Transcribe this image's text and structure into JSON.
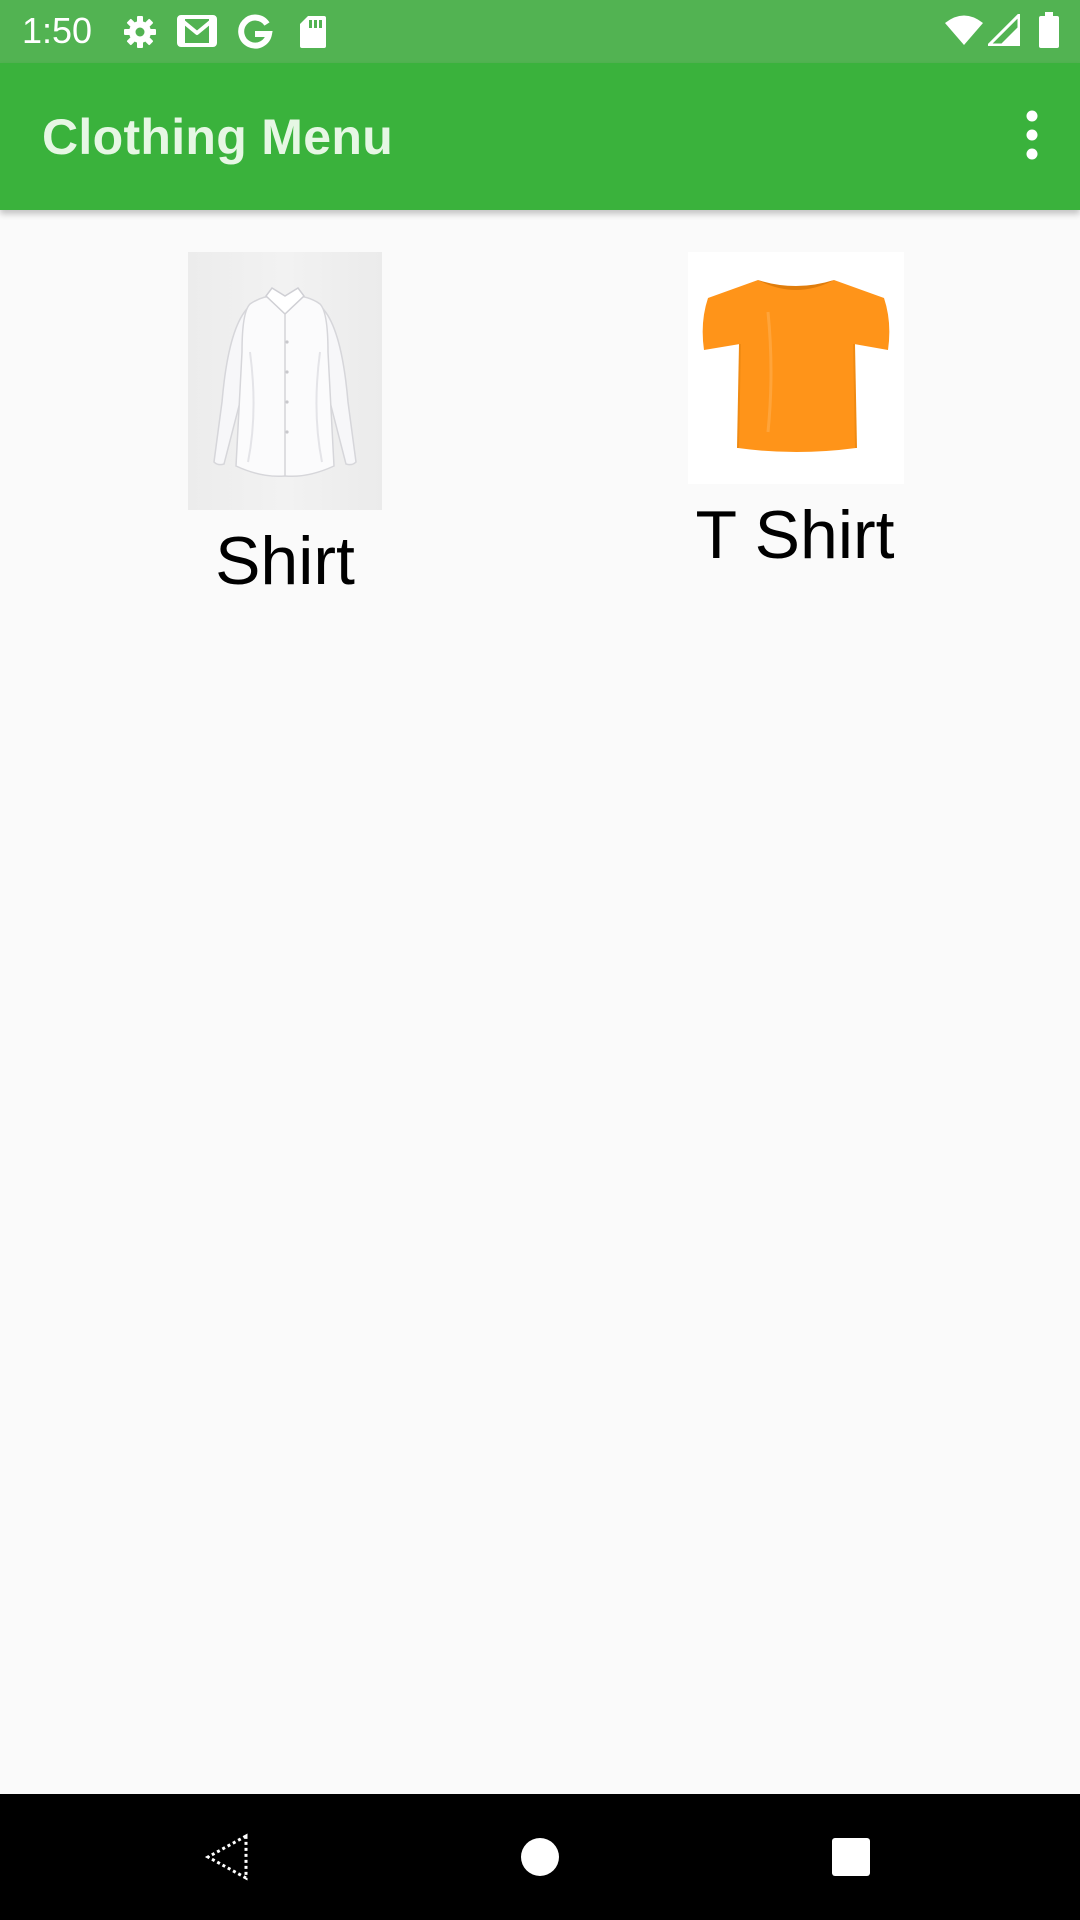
{
  "status_bar": {
    "time": "1:50",
    "left_icons": [
      "settings-icon",
      "gmail-icon",
      "google-icon",
      "sd-card-icon"
    ],
    "right_icons": [
      "wifi-icon",
      "cell-signal-icon",
      "battery-icon"
    ]
  },
  "app_bar": {
    "title": "Clothing Menu",
    "menu_icon": "more-vert-icon",
    "background_color": "#3ab23c",
    "title_color": "#e6f7e4"
  },
  "items": [
    {
      "label": "Shirt",
      "image": "white-shirt-image"
    },
    {
      "label": "T Shirt",
      "image": "orange-tshirt-image"
    }
  ],
  "nav_bar": {
    "buttons": [
      "back-icon",
      "home-icon",
      "recents-icon"
    ]
  },
  "colors": {
    "status_bar": "#52b352",
    "page_background": "#fafafa",
    "tshirt": "#ff9419"
  }
}
